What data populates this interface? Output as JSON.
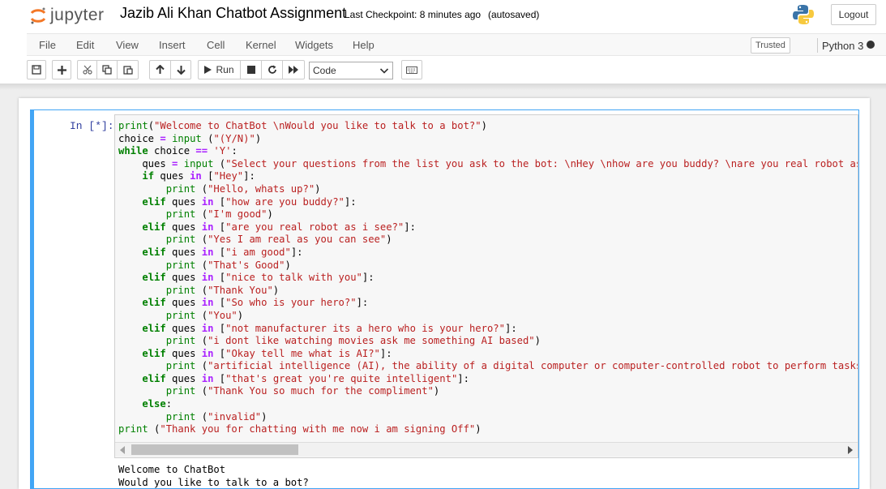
{
  "header": {
    "logo_text": "jupyter",
    "notebook_title": "Jazib Ali Khan Chatbot Assignment",
    "checkpoint": "Last Checkpoint: 8 minutes ago",
    "autosave": "(autosaved)",
    "logout_label": "Logout"
  },
  "menu": {
    "items": [
      "File",
      "Edit",
      "View",
      "Insert",
      "Cell",
      "Kernel",
      "Widgets",
      "Help"
    ],
    "trusted": "Trusted",
    "kernel": "Python 3"
  },
  "toolbar": {
    "run_label": "Run",
    "cell_type": "Code"
  },
  "cell": {
    "prompt": "In [*]:",
    "code_lines": [
      "print(\"Welcome to ChatBot \\nWould you like to talk to a bot?\")",
      "choice = input (\"(Y/N)\")",
      "while choice == 'Y':",
      "    ques = input (\"Select your questions from the list you ask to the bot: \\nHey \\nhow are you buddy? \\nare you real robot as i s",
      "    if ques in [\"Hey\"]:",
      "        print (\"Hello, whats up?\")",
      "    elif ques in [\"how are you buddy?\"]:",
      "        print (\"I'm good\")",
      "    elif ques in [\"are you real robot as i see?\"]:",
      "        print (\"Yes I am real as you can see\")",
      "    elif ques in [\"i am good\"]:",
      "        print (\"That's Good\")",
      "    elif ques in [\"nice to talk with you\"]:",
      "        print (\"Thank You\")",
      "    elif ques in [\"So who is your hero?\"]:",
      "        print (\"You\")",
      "    elif ques in [\"not manufacturer its a hero who is your hero?\"]:",
      "        print (\"i dont like watching movies ask me something AI based\")",
      "    elif ques in [\"Okay tell me what is AI?\"]:",
      "        print (\"artificial intelligence (AI), the ability of a digital computer or computer-controlled robot to perform tasks com",
      "    elif ques in [\"that's great you're quite intelligent\"]:",
      "        print (\"Thank You so much for the compliment\")",
      "    else:",
      "        print (\"invalid\")",
      "print (\"Thank you for chatting with me now i am signing Off\")"
    ],
    "output_lines": [
      "Welcome to ChatBot",
      "Would you like to talk to a bot?"
    ]
  },
  "colors": {
    "keyword": "#008000",
    "string": "#ba2121",
    "cell_border": "#42a5f5"
  },
  "icons": [
    "jupyter-logo-icon",
    "python-logo-icon",
    "save-icon",
    "plus-icon",
    "cut-icon",
    "copy-icon",
    "paste-icon",
    "arrow-up-icon",
    "arrow-down-icon",
    "play-icon",
    "stop-icon",
    "restart-icon",
    "fast-forward-icon",
    "keyboard-icon",
    "chevron-down-icon"
  ]
}
